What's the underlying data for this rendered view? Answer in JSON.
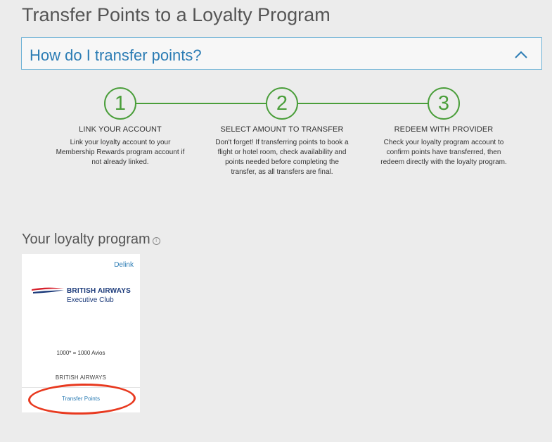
{
  "page": {
    "title": "Transfer Points to a Loyalty Program"
  },
  "accordion": {
    "label": "How do I transfer points?",
    "toggle_icon": "chevron-up-icon"
  },
  "steps": [
    {
      "number": "1",
      "title": "LINK YOUR ACCOUNT",
      "description": "Link your loyalty account to your Membership Rewards program account if not already linked."
    },
    {
      "number": "2",
      "title": "SELECT AMOUNT TO TRANSFER",
      "description": "Don't forget! If transferring points to book a flight or hotel room, check availability and points needed before completing the transfer, as all transfers are final."
    },
    {
      "number": "3",
      "title": "REDEEM WITH PROVIDER",
      "description": "Check your loyalty program account to confirm points have transferred, then redeem directly with the loyalty program."
    }
  ],
  "loyalty": {
    "heading": "Your loyalty program",
    "info_icon": "info-icon",
    "card": {
      "delink_label": "Delink",
      "logo_name": "BRITISH AIRWAYS",
      "logo_sub": "Executive Club",
      "rate": "1000* = 1000 Avios",
      "partner_name": "BRITISH AIRWAYS",
      "transfer_label": "Transfer Points"
    }
  },
  "colors": {
    "accent_blue": "#2b7cb4",
    "step_green": "#4a9e3a",
    "highlight_red": "#e8391f",
    "ba_navy": "#1b3a7a",
    "ba_red": "#d6202c"
  }
}
